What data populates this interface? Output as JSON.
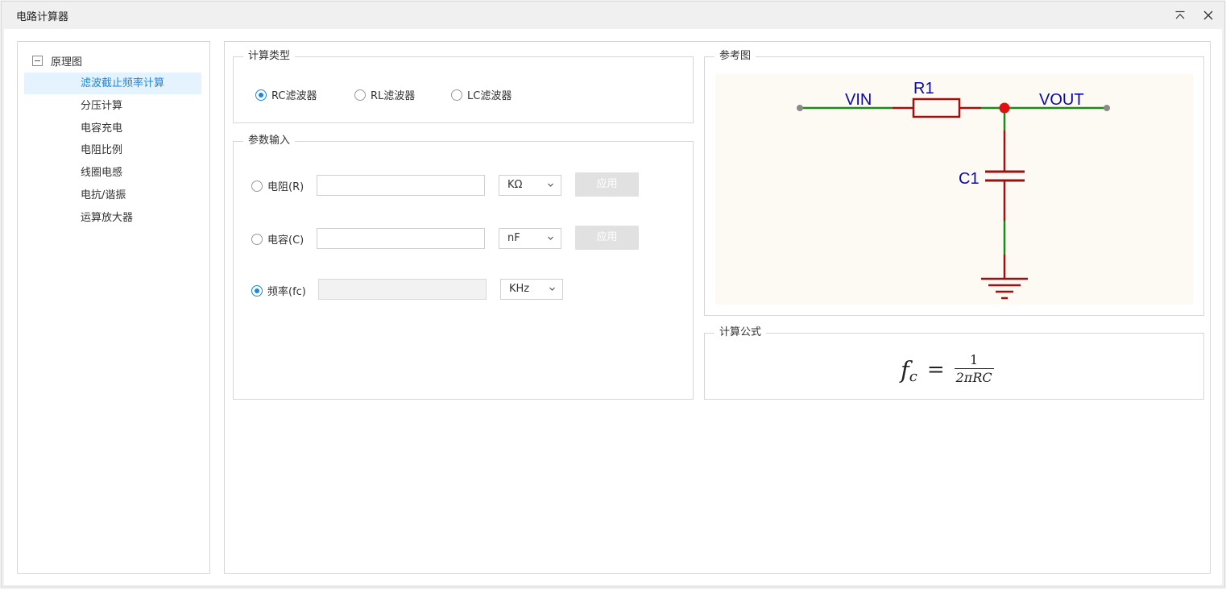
{
  "window": {
    "title": "电路计算器"
  },
  "tree": {
    "root_label": "原理图",
    "items": [
      {
        "label": "滤波截止频率计算",
        "selected": true
      },
      {
        "label": "分压计算"
      },
      {
        "label": "电容充电"
      },
      {
        "label": "电阻比例"
      },
      {
        "label": "线圈电感"
      },
      {
        "label": "电抗/谐振"
      },
      {
        "label": "运算放大器"
      }
    ]
  },
  "calc_type": {
    "title": "计算类型",
    "options": [
      {
        "label": "RC滤波器",
        "checked": true
      },
      {
        "label": "RL滤波器",
        "checked": false
      },
      {
        "label": "LC滤波器",
        "checked": false
      }
    ]
  },
  "params": {
    "title": "参数输入",
    "rows": [
      {
        "label": "电阻(R)",
        "value": "",
        "unit": "KΩ",
        "apply_label": "应用",
        "checked": false
      },
      {
        "label": "电容(C)",
        "value": "",
        "unit": "nF",
        "apply_label": "应用",
        "checked": false
      },
      {
        "label": "频率(fc)",
        "value": "",
        "unit": "KHz",
        "checked": true
      }
    ]
  },
  "reference": {
    "title": "参考图",
    "labels": {
      "vin": "VIN",
      "vout": "VOUT",
      "r1": "R1",
      "c1": "C1"
    },
    "colors": {
      "wire": "#1a8a1a",
      "component": "#a01010",
      "label": "#0a0aaa",
      "background": "#fdf9f3"
    }
  },
  "formula_box": {
    "title": "计算公式",
    "lhs": "f",
    "lhs_sub": "c",
    "eq": "=",
    "numerator": "1",
    "denominator": "2πRC"
  },
  "colors": {
    "accent": "#1a86e0",
    "selected_bg": "#e5f3ff",
    "button_disabled": "#e1e1e1"
  }
}
